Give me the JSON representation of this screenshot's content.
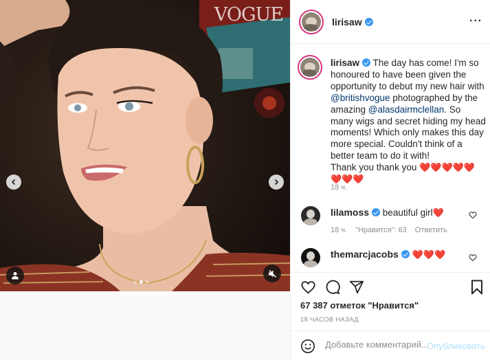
{
  "media": {
    "watermark": "VOGUE",
    "carousel_dots": 3,
    "active_dot": 1
  },
  "header": {
    "username": "lirisaw",
    "verified": true,
    "more_icon": "more-horizontal-icon"
  },
  "caption": {
    "username": "lirisaw",
    "text_1": "The day has come! I'm so honoured to have been given the opportunity to debut my new hair with ",
    "mention_1": "@britishvogue",
    "text_2": " photographed by the amazing ",
    "mention_2": "@alasdairmclellan",
    "text_3": ". So many wigs and secret hiding my head moments! Which only makes this day more special. Couldn't think of a better team to do it with!",
    "text_4": "Thank you thank you ",
    "hearts_line1": "❤️❤️❤️❤️❤️",
    "hearts_line2": "❤️❤️❤️",
    "time": "18 ч."
  },
  "comments": [
    {
      "username": "lilamoss",
      "verified": true,
      "text": "beautiful girl",
      "hearts": "❤️",
      "time": "18 ч.",
      "likes": "\"Нравится\": 63",
      "reply": "Ответить"
    },
    {
      "username": "themarcjacobs",
      "verified": true,
      "text": "",
      "hearts": "❤️❤️❤️"
    }
  ],
  "actions": {
    "like_icon": "heart-outline-icon",
    "comment_icon": "comment-icon",
    "share_icon": "share-icon",
    "save_icon": "bookmark-icon"
  },
  "likes_text": "67 387 отметок \"Нравится\"",
  "time_ago": "18 часов назад",
  "add_comment": {
    "placeholder": "Добавьте комментарий...",
    "publish_label": "Опубликовать",
    "publish_color": "#b2dffc"
  },
  "colors": {
    "link": "#00376b",
    "verified": "#3897f0",
    "heart": "#ed1c24",
    "story_ring": "#d9317a"
  }
}
